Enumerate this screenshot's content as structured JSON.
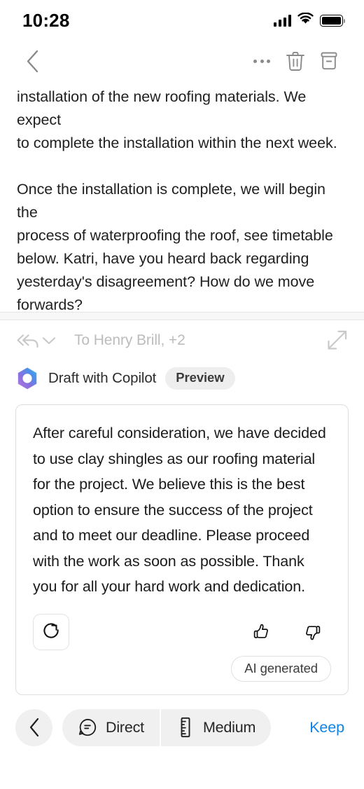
{
  "status_bar": {
    "time": "10:28",
    "signal_icon": "cellular-signal-icon",
    "wifi_icon": "wifi-icon",
    "battery_icon": "battery-full-icon"
  },
  "top_nav": {
    "back_icon": "chevron-left-icon",
    "more_icon": "more-horizontal-icon",
    "delete_icon": "trash-icon",
    "archive_icon": "archive-icon"
  },
  "email": {
    "body": "installation of the new roofing materials. We expect\nto complete the installation within the next week.\n\nOnce the installation is complete, we will begin the\nprocess of waterproofing the roof, see timetable\nbelow. Katri, have you heard back regarding\nyesterday's disagreement? How do we move\nforwards?\n\nLet me know if you have any questions,\nKevin S",
    "expand_icon": "more-horizontal-icon"
  },
  "compose": {
    "reply_all_icon": "reply-all-icon",
    "chevron_down_icon": "chevron-down-icon",
    "recipients": "To Henry Brill, +2",
    "expand_icon": "expand-diagonal-icon",
    "copilot_icon": "copilot-icon",
    "copilot_label": "Draft with Copilot",
    "preview_badge": "Preview"
  },
  "draft": {
    "text": "After careful consideration, we have decided to use clay shingles as our roofing material for the project. We believe this is the best option to ensure the success of the project and to meet our deadline. Please proceed with the work as soon as possible.  Thank you for all your hard work and dedication.",
    "regenerate_icon": "refresh-icon",
    "thumbs_up_icon": "thumbs-up-icon",
    "thumbs_down_icon": "thumbs-down-icon",
    "ai_badge": "AI generated"
  },
  "bottom_bar": {
    "back_icon": "chevron-left-icon",
    "tone": {
      "icon": "chat-bubble-lines-icon",
      "label": "Direct"
    },
    "length": {
      "icon": "ruler-icon",
      "label": "Medium"
    },
    "keep_label": "Keep"
  },
  "colors": {
    "accent_link": "#1184e8",
    "icon_gray": "#8a8a8a",
    "muted_text": "#bcbcbc",
    "chip_bg": "#f0f0f0",
    "card_border": "#dedede"
  }
}
